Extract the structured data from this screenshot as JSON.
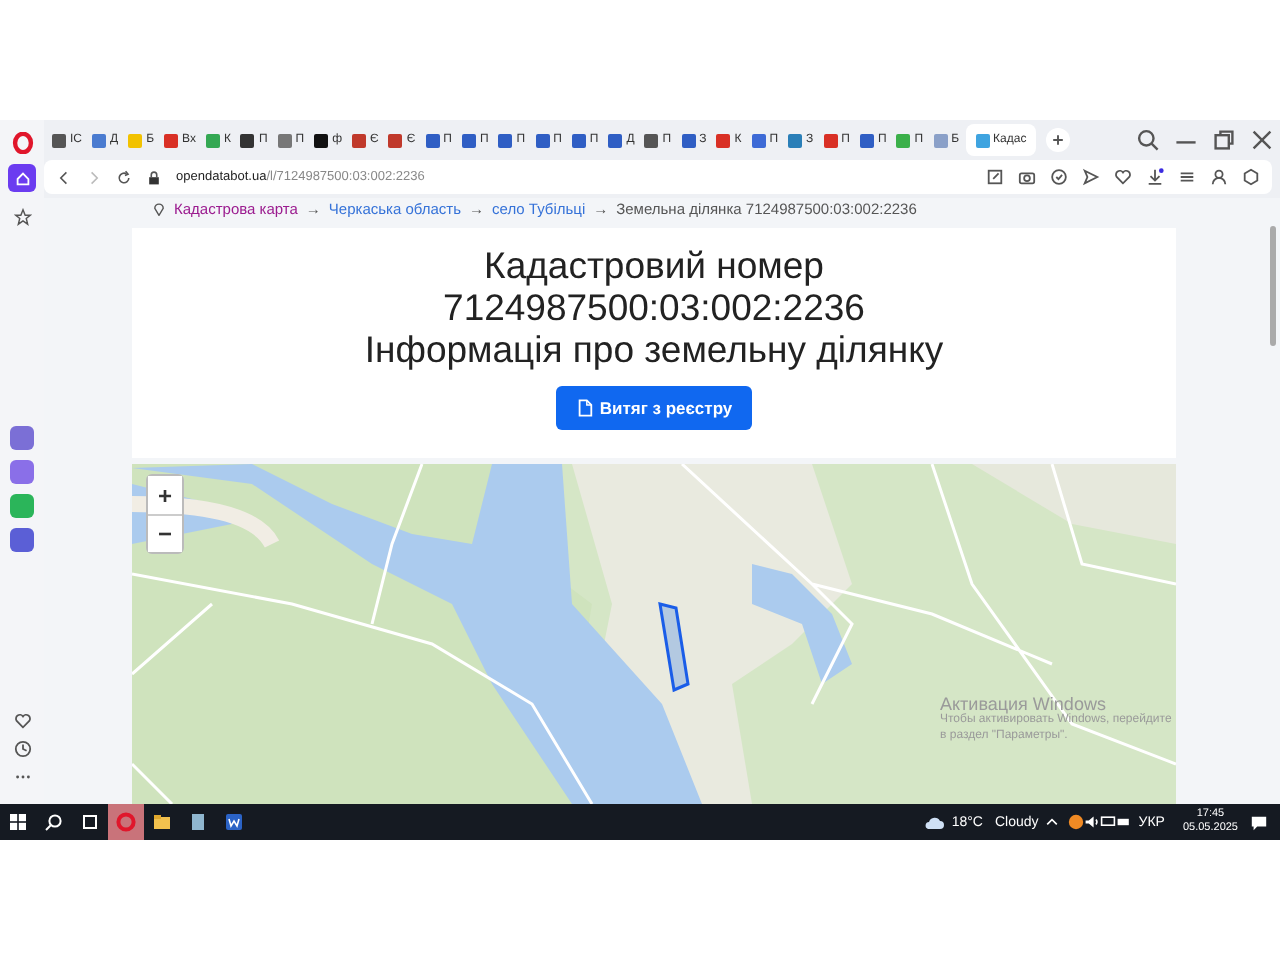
{
  "sidebar": {
    "items": [
      {
        "kind": "home",
        "selected": true
      },
      {
        "kind": "bookmarks",
        "selected": false
      }
    ]
  },
  "tabs": [
    {
      "title": "ІС",
      "selected": false
    },
    {
      "title": "Д",
      "selected": false
    },
    {
      "title": "Б",
      "selected": false
    },
    {
      "title": "Вх",
      "selected": false
    },
    {
      "title": "К",
      "selected": false
    },
    {
      "title": "П",
      "selected": false
    },
    {
      "title": "П",
      "selected": false
    },
    {
      "title": "ф",
      "selected": false
    },
    {
      "title": "Є",
      "selected": false
    },
    {
      "title": "Є",
      "selected": false
    },
    {
      "title": "П",
      "selected": false
    },
    {
      "title": "П",
      "selected": false
    },
    {
      "title": "П",
      "selected": false
    },
    {
      "title": "П",
      "selected": false
    },
    {
      "title": "П",
      "selected": false
    },
    {
      "title": "Д",
      "selected": false
    },
    {
      "title": "П",
      "selected": false
    },
    {
      "title": "З",
      "selected": false
    },
    {
      "title": "К",
      "selected": false
    },
    {
      "title": "П",
      "selected": false
    },
    {
      "title": "З",
      "selected": false
    },
    {
      "title": "П",
      "selected": false
    },
    {
      "title": "П",
      "selected": false
    },
    {
      "title": "П",
      "selected": false
    },
    {
      "title": "Б",
      "selected": false
    },
    {
      "title": "Кадас",
      "selected": true
    }
  ],
  "address_bar": {
    "host": "opendatabot.ua",
    "path": "/l/7124987500:03:002:2236"
  },
  "breadcrumbs": [
    {
      "label": "Кадастрова карта",
      "kind": "visited"
    },
    {
      "label": "→",
      "kind": "separator"
    },
    {
      "label": "Черкаська область",
      "kind": "link"
    },
    {
      "label": "→",
      "kind": "separator"
    },
    {
      "label": "село Тубільці",
      "kind": "link"
    },
    {
      "label": "→",
      "kind": "separator"
    },
    {
      "label": "Земельна ділянка 7124987500:03:002:2236",
      "kind": "current"
    }
  ],
  "header": {
    "title_lines": [
      "Кадастровий номер",
      "7124987500:03:002:2236",
      "Інформація про земельну ділянку"
    ],
    "button": "Витяг з реєстру"
  },
  "map": {
    "zoom_in": "+",
    "zoom_out": "−"
  },
  "activation_notice": {
    "title": "Активация Windows",
    "text": "Чтобы активировать Windows, перейдите в раздел \"Параметры\"."
  },
  "taskbar": {
    "weather": {
      "temp": "18°C",
      "condition": "Cloudy"
    },
    "language": "УКР",
    "time": "17:45",
    "date": "05.05.2025"
  }
}
